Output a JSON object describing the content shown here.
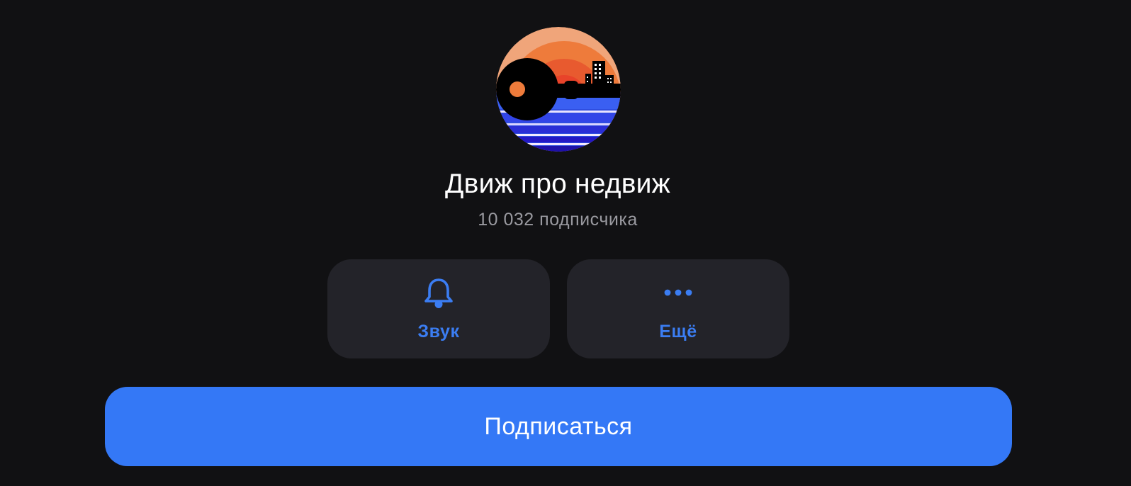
{
  "channel": {
    "title": "Движ про недвиж",
    "subscribers": "10 032 подписчика"
  },
  "actions": [
    {
      "label": "Звук",
      "icon": "bell-icon"
    },
    {
      "label": "Ещё",
      "icon": "more-dots-icon"
    }
  ],
  "subscribe_label": "Подписаться",
  "colors": {
    "background": "#111113",
    "tile": "#232329",
    "accent": "#3b7df2",
    "button": "#3478f6",
    "subtitle": "#9a9aa0"
  }
}
